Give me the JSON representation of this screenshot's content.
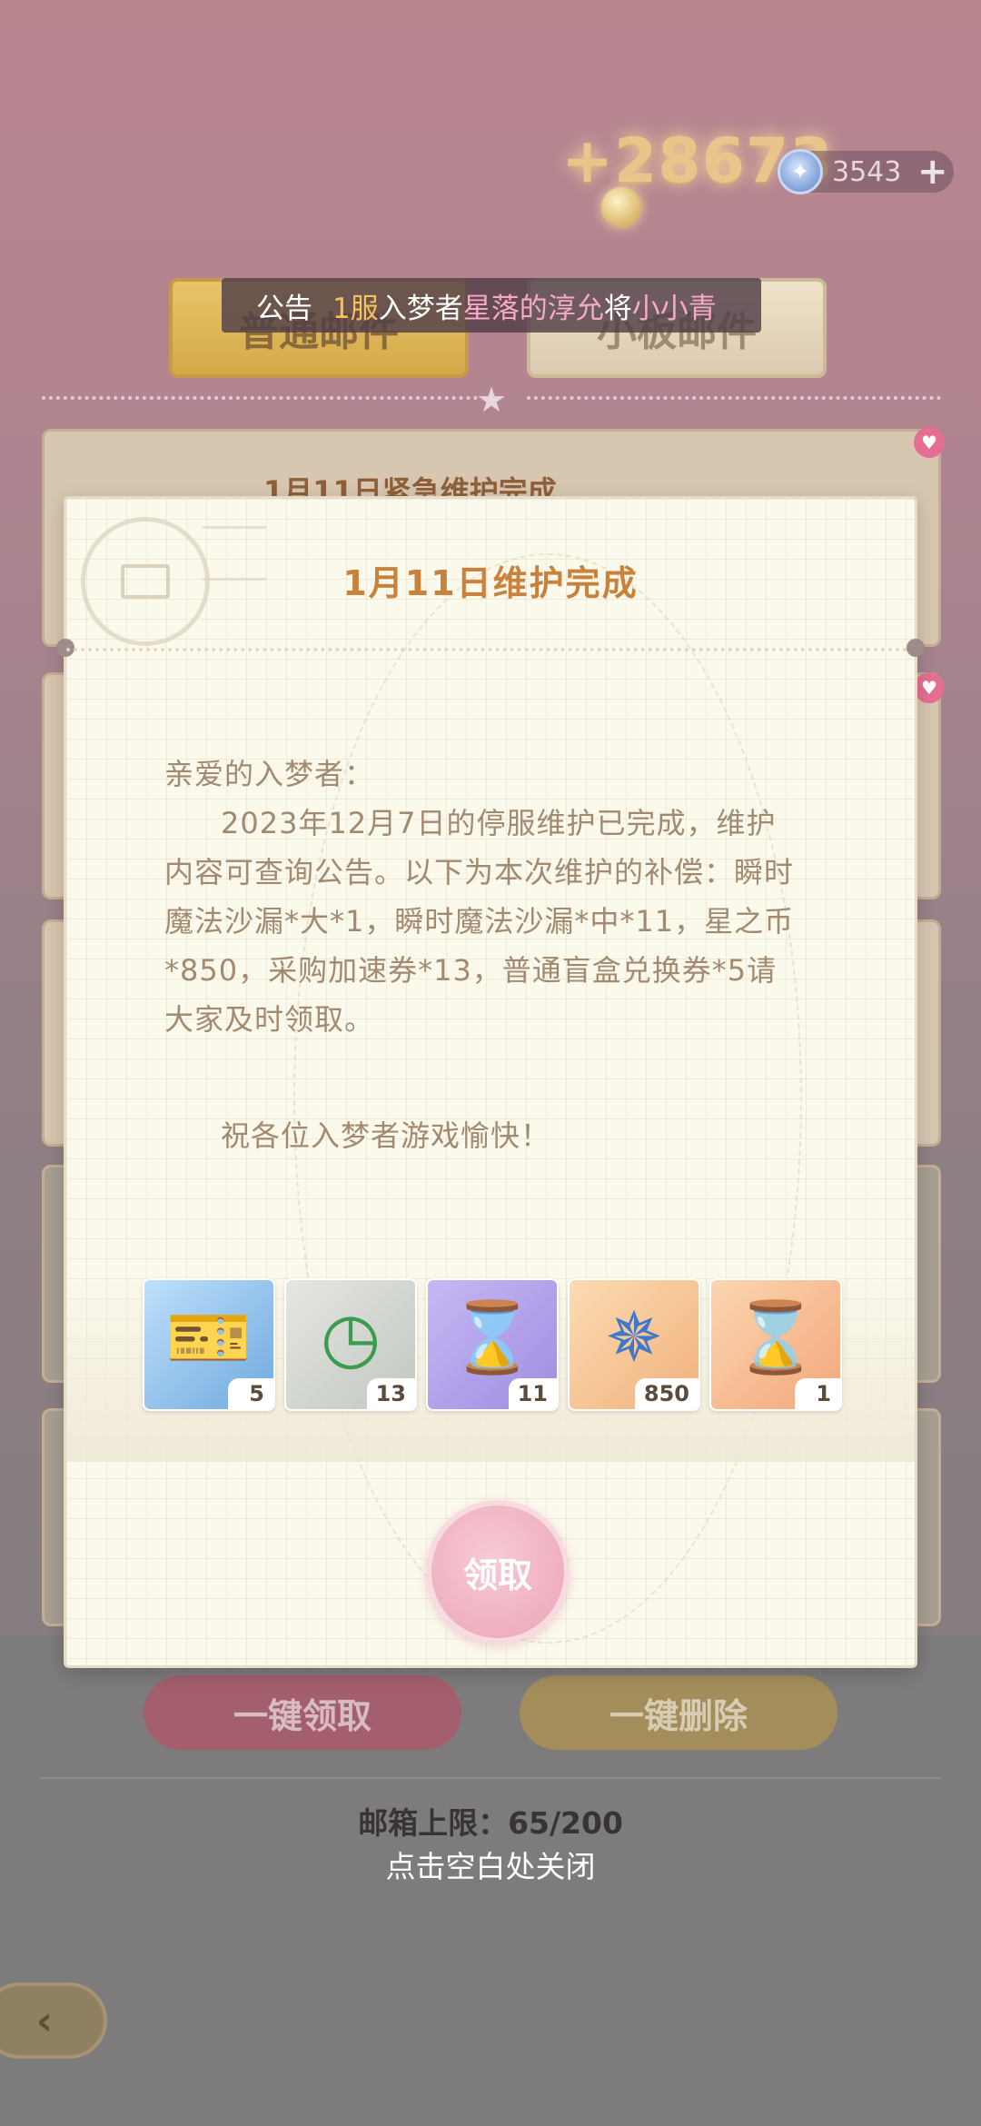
{
  "header": {
    "bonus_text": "+28673",
    "star_coin_value": "3543",
    "plus_label": "+"
  },
  "tabs": {
    "normal": "普通邮件",
    "small": "小板邮件"
  },
  "announcement": {
    "label": "公告",
    "server": "1服",
    "seg1": "入梦者",
    "name": "星落的淳允",
    "seg2": "将",
    "target": "小小青"
  },
  "mail_list": {
    "first_title": "1月11日紧急维护完成"
  },
  "modal": {
    "title": "1月11日维护完成",
    "greeting": "亲爱的入梦者：",
    "body": "2023年12月7日的停服维护已完成，维护内容可查询公告。以下为本次维护的补偿：瞬时魔法沙漏*大*1，瞬时魔法沙漏*中*11，星之币*850，采购加速券*13，普通盲盒兑换券*5请大家及时领取。",
    "wish": "祝各位入梦者游戏愉快！",
    "rewards": [
      {
        "count": "5",
        "icon": "ticket-icon"
      },
      {
        "count": "13",
        "icon": "speedup-coupon-icon"
      },
      {
        "count": "11",
        "icon": "hourglass-medium-icon"
      },
      {
        "count": "850",
        "icon": "star-coin-icon"
      },
      {
        "count": "1",
        "icon": "hourglass-large-icon"
      }
    ],
    "claim_label": "领取"
  },
  "footer": {
    "claim_all": "一键领取",
    "delete_all": "一键删除",
    "mailbox_limit": "邮箱上限：65/200",
    "close_hint": "点击空白处关闭"
  },
  "colors": {
    "accent_title": "#c9823c",
    "claim_pink": "#eda4b5",
    "body_text": "#a28a70"
  }
}
